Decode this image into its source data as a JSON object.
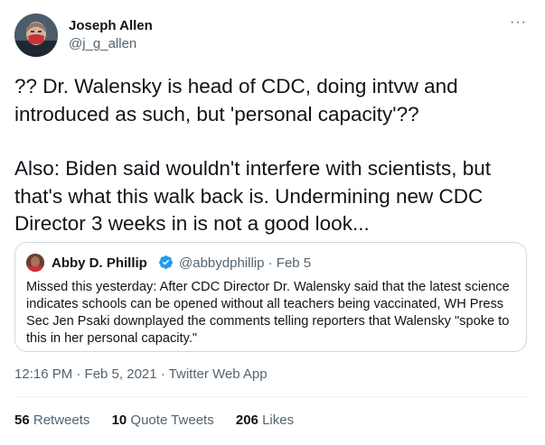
{
  "author": {
    "name": "Joseph Allen",
    "handle": "@j_g_allen"
  },
  "more_icon": "···",
  "tweet_paragraphs": [
    "?? Dr. Walensky is head of CDC, doing intvw and introduced as such, but 'personal capacity'??",
    "Also: Biden said wouldn't interfere with scientists, but that's what this walk back is. Undermining new CDC Director 3 weeks in is not a good look..."
  ],
  "quoted": {
    "name": "Abby D. Phillip",
    "handle_date": "@abbydphillip · Feb 5",
    "text": "Missed this yesterday: After CDC Director Dr. Walensky said that the latest science indicates schools can be opened without all teachers being vaccinated, WH Press Sec Jen Psaki downplayed the comments telling reporters that Walensky \"spoke to this in her personal capacity.\""
  },
  "meta": {
    "timestamp": "12:16 PM · Feb 5, 2021 · ",
    "app": "Twitter Web App"
  },
  "stats": [
    {
      "num": "56",
      "label": "Retweets"
    },
    {
      "num": "10",
      "label": "Quote Tweets"
    },
    {
      "num": "206",
      "label": "Likes"
    }
  ],
  "colors": {
    "text": "#0f1419",
    "secondary": "#536471",
    "border": "#cfd9de",
    "verified": "#1d9bf0",
    "mask": "#c8323a"
  }
}
